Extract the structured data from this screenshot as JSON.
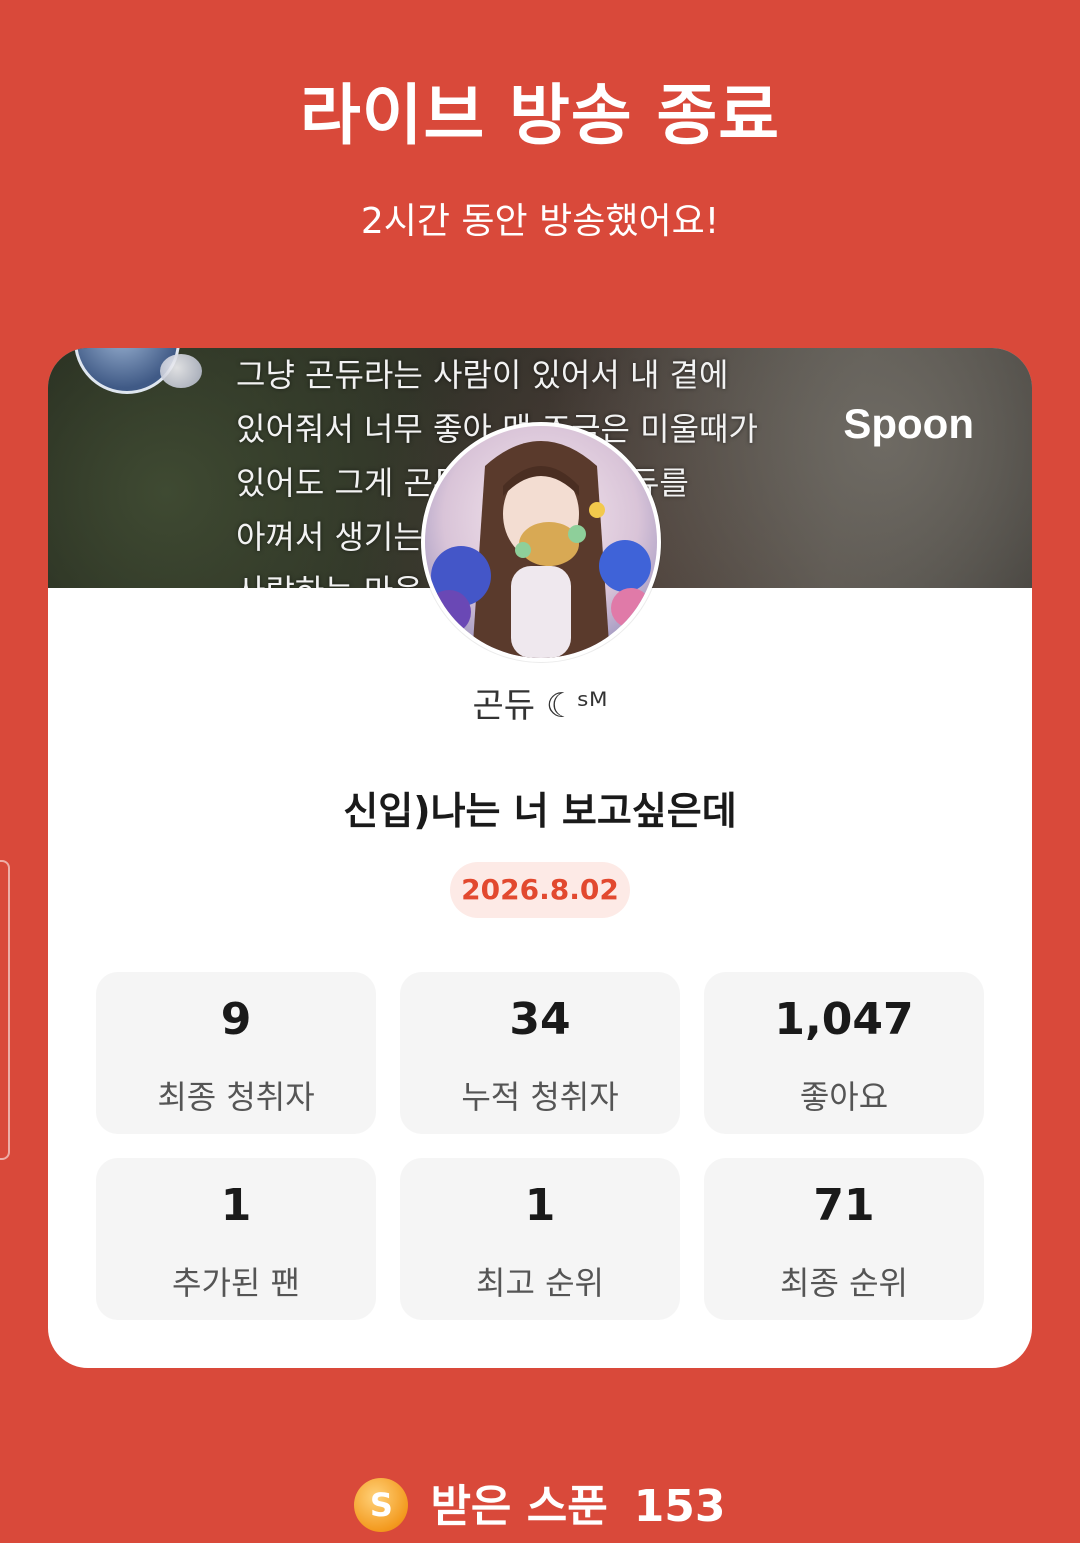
{
  "header": {
    "title": "라이브 방송 종료",
    "subtitle": "2시간 동안 방송했어요!"
  },
  "card": {
    "banner_text": "그냥 곤듀라는 사람이 있어서 내 곁에\n있어줘서 너무 좋아 맨 조금은 미울때가\n있어도 그게 곤듀라서 나도 곤듀를\n아껴서 생기는 좋아하고\n사랑하는 마음 파 태어나져서",
    "brand": "Spoon",
    "nickname": "곤듀 ☾ˢᴹ",
    "live_title": "신입)나는 너 보고싶은데",
    "date": "2026.8.02"
  },
  "stats": [
    {
      "value": "9",
      "label": "최종 청취자"
    },
    {
      "value": "34",
      "label": "누적 청취자"
    },
    {
      "value": "1,047",
      "label": "좋아요"
    },
    {
      "value": "1",
      "label": "추가된 팬"
    },
    {
      "value": "1",
      "label": "최고 순위"
    },
    {
      "value": "71",
      "label": "최종 순위"
    }
  ],
  "footer": {
    "spoon_icon_letter": "S",
    "spoon_label": "받은 스푼",
    "spoon_count": "153"
  },
  "colors": {
    "background": "#d9493a",
    "accent": "#e2492f",
    "badge_bg": "#fdeae6"
  }
}
